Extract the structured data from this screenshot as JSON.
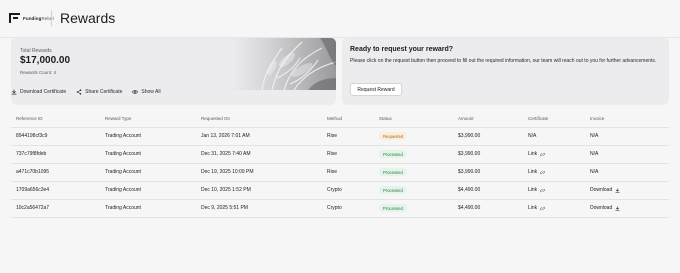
{
  "header": {
    "brand_name": "FundingRebel",
    "brand_bold": "FundingRebel",
    "page_title": "Rewards"
  },
  "summary": {
    "total_label": "Total Rewards",
    "total_value": "$17,000.00",
    "count_label": "Rewards Count: 4",
    "actions": [
      {
        "label": "Download Certificate",
        "icon": "download-icon"
      },
      {
        "label": "Share Certificate",
        "icon": "share-icon"
      },
      {
        "label": "Show All",
        "icon": "eye-icon"
      }
    ]
  },
  "request": {
    "title": "Ready to request your reward?",
    "description": "Please click on the request button then proceed to fill out the required information, our team will reach out to you for further advancements.",
    "button_label": "Request Reward"
  },
  "table": {
    "columns": [
      "Reference ID",
      "Reward Type",
      "Requested On",
      "Method",
      "Status",
      "Amount",
      "Certificate",
      "Invoice"
    ],
    "rows": [
      {
        "ref": "8944198cf3c9",
        "type": "Trading Account",
        "date": "Jan 13, 2026 7:01 AM",
        "method": "Rise",
        "status": "Requested",
        "amount": "$3,990.00",
        "certificate": "N/A",
        "invoice": "N/A"
      },
      {
        "ref": "737c79f8fdeb",
        "type": "Trading Account",
        "date": "Dec 31, 2025 7:40 AM",
        "method": "Rise",
        "status": "Processed",
        "amount": "$3,990.00",
        "certificate": "Link",
        "invoice": "N/A"
      },
      {
        "ref": "a471c70b1095",
        "type": "Trading Account",
        "date": "Dec 19, 2025 10:09 PM",
        "method": "Rise",
        "status": "Processed",
        "amount": "$3,990.00",
        "certificate": "Link",
        "invoice": "N/A"
      },
      {
        "ref": "1709a656c3e4",
        "type": "Trading Account",
        "date": "Dec 10, 2025 1:52 PM",
        "method": "Crypto",
        "status": "Processed",
        "amount": "$4,490.00",
        "certificate": "Link",
        "invoice": "Download"
      },
      {
        "ref": "10c2a56472a7",
        "type": "Trading Account",
        "date": "Dec 9, 2025 5:51 PM",
        "method": "Crypto",
        "status": "Processed",
        "amount": "$4,490.00",
        "certificate": "Link",
        "invoice": "Download"
      }
    ]
  },
  "colors": {
    "requested_badge": "#fbeede",
    "processed_badge": "#e4f4e8",
    "card_bg": "#ececee"
  }
}
